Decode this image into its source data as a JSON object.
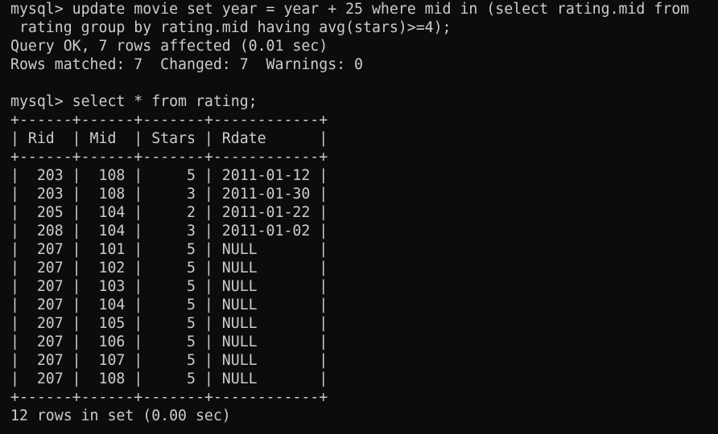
{
  "terminal": {
    "lines": [
      "mysql> update movie set year = year + 25 where mid in (select rating.mid from",
      " rating group by rating.mid having avg(stars)>=4);",
      "Query OK, 7 rows affected (0.01 sec)",
      "Rows matched: 7  Changed: 7  Warnings: 0",
      "",
      "mysql> select * from rating;",
      "+------+------+-------+------------+",
      "| Rid  | Mid  | Stars | Rdate      |",
      "+------+------+-------+------------+",
      "|  203 |  108 |     5 | 2011-01-12 |",
      "|  203 |  108 |     3 | 2011-01-30 |",
      "|  205 |  104 |     2 | 2011-01-22 |",
      "|  208 |  104 |     3 | 2011-01-02 |",
      "|  207 |  101 |     5 | NULL       |",
      "|  207 |  102 |     5 | NULL       |",
      "|  207 |  103 |     5 | NULL       |",
      "|  207 |  104 |     5 | NULL       |",
      "|  207 |  105 |     5 | NULL       |",
      "|  207 |  106 |     5 | NULL       |",
      "|  207 |  107 |     5 | NULL       |",
      "|  207 |  108 |     5 | NULL       |",
      "+------+------+-------+------------+",
      "12 rows in set (0.00 sec)"
    ]
  }
}
